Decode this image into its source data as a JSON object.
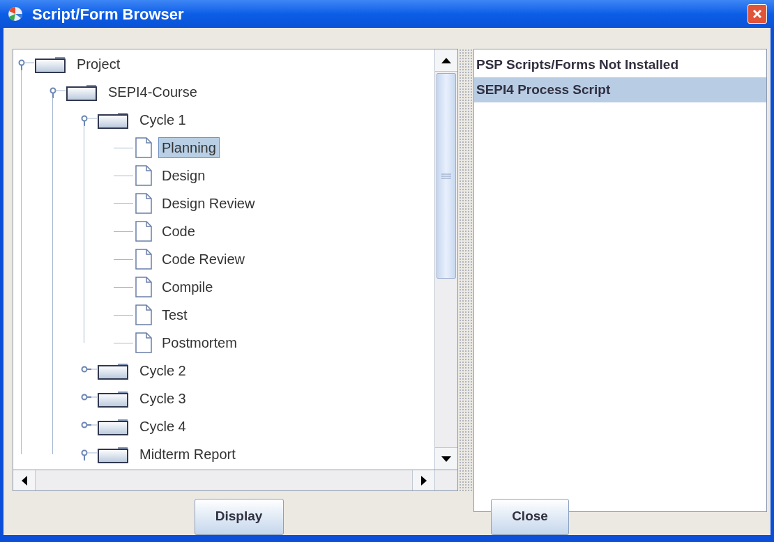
{
  "window": {
    "title": "Script/Form Browser"
  },
  "tree": [
    {
      "kind": "folder",
      "label": "Project",
      "expanded": true,
      "selected": false,
      "children": [
        {
          "kind": "folder",
          "label": "SEPI4-Course",
          "expanded": true,
          "selected": false,
          "children": [
            {
              "kind": "folder",
              "label": "Cycle 1",
              "expanded": true,
              "selected": false,
              "children": [
                {
                  "kind": "file",
                  "label": "Planning",
                  "selected": true
                },
                {
                  "kind": "file",
                  "label": "Design",
                  "selected": false
                },
                {
                  "kind": "file",
                  "label": "Design Review",
                  "selected": false
                },
                {
                  "kind": "file",
                  "label": "Code",
                  "selected": false
                },
                {
                  "kind": "file",
                  "label": "Code Review",
                  "selected": false
                },
                {
                  "kind": "file",
                  "label": "Compile",
                  "selected": false
                },
                {
                  "kind": "file",
                  "label": "Test",
                  "selected": false
                },
                {
                  "kind": "file",
                  "label": "Postmortem",
                  "selected": false
                }
              ]
            },
            {
              "kind": "folder",
              "label": "Cycle 2",
              "expanded": false,
              "selected": false
            },
            {
              "kind": "folder",
              "label": "Cycle 3",
              "expanded": false,
              "selected": false
            },
            {
              "kind": "folder",
              "label": "Cycle 4",
              "expanded": false,
              "selected": false
            },
            {
              "kind": "folder",
              "label": "Midterm Report",
              "expanded": true,
              "selected": false
            }
          ]
        }
      ]
    }
  ],
  "scripts": [
    {
      "label": "PSP Scripts/Forms Not Installed",
      "selected": false
    },
    {
      "label": "SEPI4 Process Script",
      "selected": true
    }
  ],
  "buttons": [
    "Display",
    "Close"
  ]
}
